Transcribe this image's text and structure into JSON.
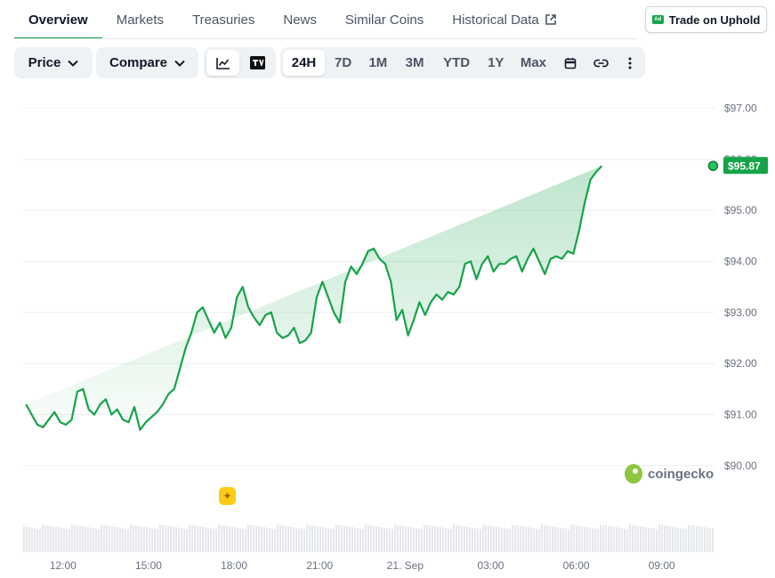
{
  "tabs": [
    {
      "label": "Overview",
      "active": true
    },
    {
      "label": "Markets"
    },
    {
      "label": "Treasuries"
    },
    {
      "label": "News"
    },
    {
      "label": "Similar Coins"
    },
    {
      "label": "Historical Data",
      "external": true
    }
  ],
  "trade": {
    "ad_badge": "Ad",
    "label": "Trade on Uphold"
  },
  "toolbar": {
    "price_label": "Price",
    "compare_label": "Compare",
    "chart_type_icons": [
      "line-chart-icon",
      "tradingview-icon"
    ],
    "ranges": [
      "24H",
      "7D",
      "1M",
      "3M",
      "YTD",
      "1Y",
      "Max"
    ],
    "selected_range": "24H",
    "tool_icons": [
      "calendar-icon",
      "link-icon",
      "more-vertical-icon"
    ]
  },
  "watermark": "coingecko",
  "colors": {
    "accent": "#16a34a",
    "line": "#16a34a",
    "tag_bg": "#16a34a",
    "badge": "#facc15"
  },
  "chart_data": {
    "type": "area",
    "ylim": [
      89.7,
      97.2
    ],
    "yticks": [
      {
        "value": 97,
        "label": "$97.00"
      },
      {
        "value": 96,
        "label": "$96.00"
      },
      {
        "value": 95,
        "label": "$95.00"
      },
      {
        "value": 94,
        "label": "$94.00"
      },
      {
        "value": 93,
        "label": "$93.00"
      },
      {
        "value": 92,
        "label": "$92.00"
      },
      {
        "value": 91,
        "label": "$91.00"
      },
      {
        "value": 90,
        "label": "$90.00"
      }
    ],
    "xlim": [
      10.6,
      34.85
    ],
    "xticks": [
      {
        "value": 12,
        "label": "12:00"
      },
      {
        "value": 15,
        "label": "15:00"
      },
      {
        "value": 18,
        "label": "18:00"
      },
      {
        "value": 21,
        "label": "21:00"
      },
      {
        "value": 24,
        "label": "21. Sep"
      },
      {
        "value": 27,
        "label": "03:00"
      },
      {
        "value": 30,
        "label": "06:00"
      },
      {
        "value": 33,
        "label": "09:00"
      }
    ],
    "current_price_label": "$95.87",
    "x": [
      10.7,
      10.9,
      11.1,
      11.3,
      11.5,
      11.7,
      11.9,
      12.1,
      12.3,
      12.5,
      12.7,
      12.9,
      13.1,
      13.3,
      13.5,
      13.7,
      13.9,
      14.1,
      14.3,
      14.5,
      14.7,
      14.9,
      15.1,
      15.3,
      15.5,
      15.7,
      15.9,
      16.1,
      16.3,
      16.5,
      16.7,
      16.9,
      17.1,
      17.3,
      17.5,
      17.7,
      17.9,
      18.1,
      18.3,
      18.5,
      18.7,
      18.9,
      19.1,
      19.3,
      19.5,
      19.7,
      19.9,
      20.1,
      20.3,
      20.5,
      20.7,
      20.9,
      21.1,
      21.3,
      21.5,
      21.7,
      21.9,
      22.1,
      22.3,
      22.5,
      22.7,
      22.9,
      23.1,
      23.3,
      23.5,
      23.7,
      23.9,
      24.1,
      24.3,
      24.5,
      24.7,
      24.9,
      25.1,
      25.3,
      25.5,
      25.7,
      25.9,
      26.1,
      26.3,
      26.5,
      26.7,
      26.9,
      27.1,
      27.3,
      27.5,
      27.7,
      27.9,
      28.1,
      28.3,
      28.5,
      28.7,
      28.9,
      29.1,
      29.3,
      29.5,
      29.7,
      29.9,
      30.1,
      30.3,
      30.5,
      30.7,
      30.9,
      31.1,
      31.3,
      31.5,
      31.7,
      31.9,
      32.1,
      32.3,
      32.5,
      32.7,
      32.9,
      33.1,
      33.3,
      33.5,
      33.7,
      33.9,
      34.1,
      34.3,
      34.5,
      34.7,
      34.8
    ],
    "y": [
      91.2,
      91.0,
      90.8,
      90.75,
      90.9,
      91.05,
      90.85,
      90.8,
      90.9,
      91.45,
      91.5,
      91.1,
      91.0,
      91.2,
      91.3,
      91.0,
      91.1,
      90.9,
      90.85,
      91.15,
      90.7,
      90.85,
      90.95,
      91.05,
      91.2,
      91.4,
      91.5,
      91.9,
      92.3,
      92.6,
      93.0,
      93.1,
      92.85,
      92.6,
      92.8,
      92.5,
      92.7,
      93.3,
      93.5,
      93.1,
      92.9,
      92.75,
      92.95,
      93.0,
      92.6,
      92.5,
      92.55,
      92.7,
      92.4,
      92.45,
      92.6,
      93.3,
      93.6,
      93.3,
      93.0,
      92.8,
      93.6,
      93.9,
      93.75,
      93.95,
      94.2,
      94.25,
      94.05,
      93.95,
      93.6,
      92.85,
      93.05,
      92.55,
      92.85,
      93.2,
      92.95,
      93.2,
      93.35,
      93.25,
      93.4,
      93.35,
      93.5,
      93.95,
      94.0,
      93.65,
      93.95,
      94.1,
      93.8,
      93.95,
      93.95,
      94.05,
      94.1,
      93.8,
      94.05,
      94.25,
      94.0,
      93.75,
      94.05,
      94.1,
      94.05,
      94.2,
      94.15,
      94.6,
      95.15,
      95.6,
      95.75,
      95.87
    ],
    "volume_note": "volume histogram"
  }
}
